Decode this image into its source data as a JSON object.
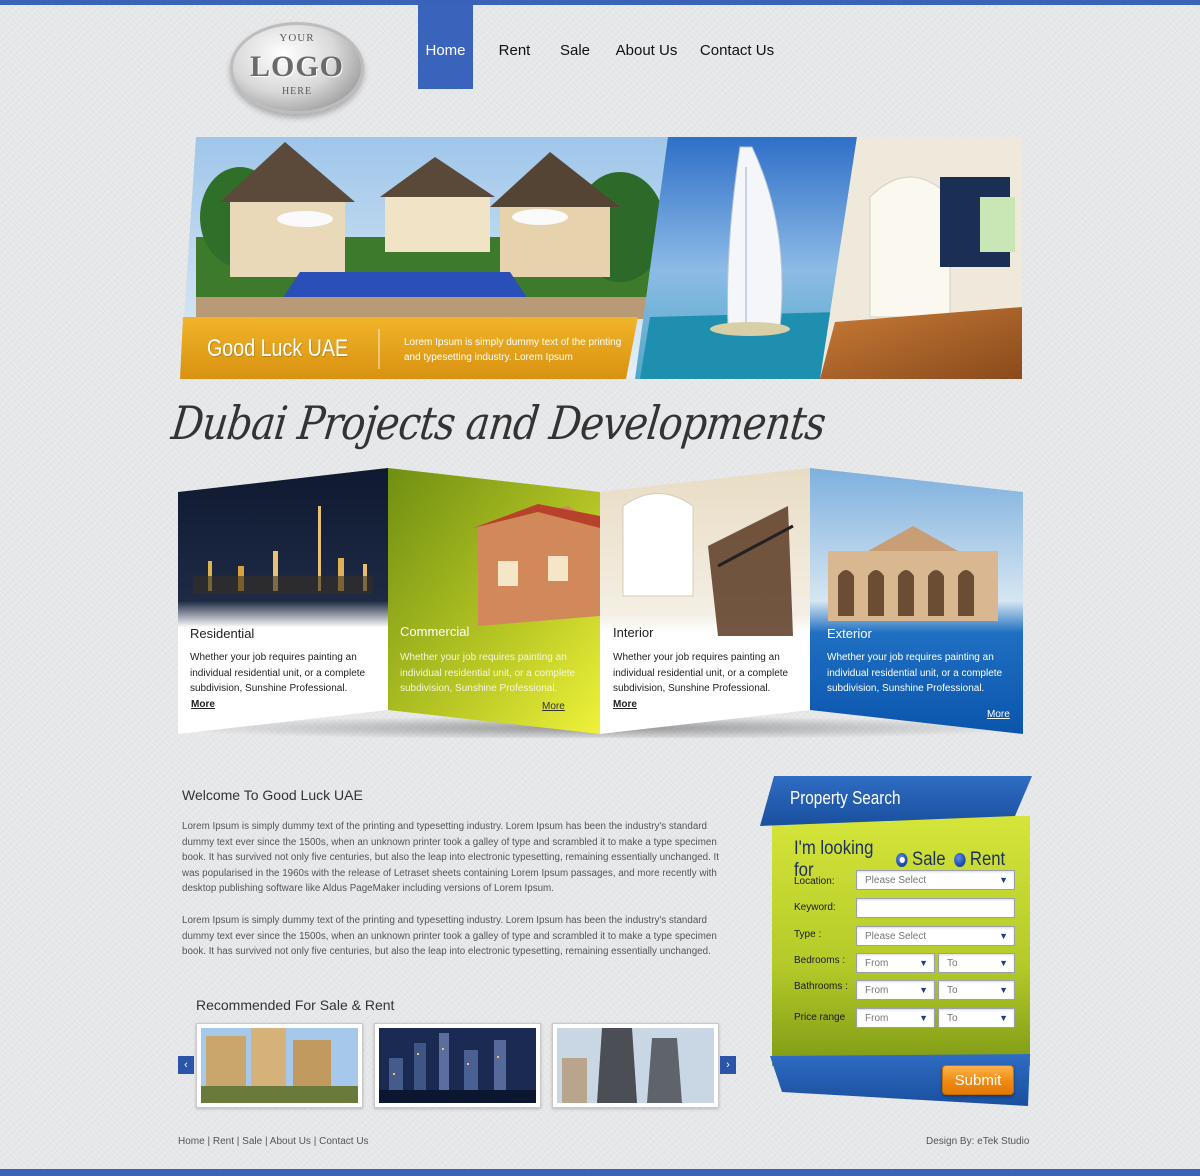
{
  "logo": {
    "top": "YOUR",
    "main": "LOGO",
    "bottom": "HERE"
  },
  "nav": {
    "items": [
      {
        "label": "Home",
        "active": true
      },
      {
        "label": "Rent"
      },
      {
        "label": "Sale"
      },
      {
        "label": "About Us"
      },
      {
        "label": "Contact Us"
      }
    ]
  },
  "hero": {
    "title": "Good Luck UAE",
    "text": "Lorem Ipsum is simply dummy text of the printing and typesetting industry. Lorem Ipsum"
  },
  "section_heading": "Dubai Projects and Developments",
  "categories": [
    {
      "title": "Residential",
      "text": "Whether your job requires painting an individual residential unit, or a complete subdivision, Sunshine Professional.",
      "more": "More"
    },
    {
      "title": "Commercial",
      "text": "Whether your job requires painting an individual residential unit, or a complete subdivision, Sunshine Professional.",
      "more": "More"
    },
    {
      "title": "Interior",
      "text": "Whether your job requires painting an individual residential unit, or a complete subdivision, Sunshine Professional.",
      "more": "More"
    },
    {
      "title": "Exterior",
      "text": "Whether your job requires painting an individual residential unit, or a complete subdivision, Sunshine Professional.",
      "more": "More"
    }
  ],
  "welcome": {
    "title": "Welcome To Good Luck UAE",
    "p1": "Lorem Ipsum is simply dummy text of the printing and typesetting industry. Lorem Ipsum has been the industry's standard dummy text ever since the 1500s, when an unknown printer took a galley of type and scrambled it to make a type specimen book. It has survived not only five centuries, but also the leap into electronic typesetting, remaining essentially unchanged. It was popularised in the 1960s with the release of Letraset sheets containing Lorem Ipsum passages, and more recently with desktop publishing software like Aldus PageMaker including versions of Lorem Ipsum.",
    "p2": "Lorem Ipsum is simply dummy text of the printing and typesetting industry. Lorem Ipsum has been the industry's standard dummy text ever since the 1500s, when an unknown printer took a galley of type and scrambled it to make a type specimen book. It has survived not only five centuries, but also the leap into electronic typesetting, remaining essentially unchanged."
  },
  "recommended": {
    "title": "Recommended For Sale & Rent",
    "prev": "‹",
    "next": "›"
  },
  "search": {
    "title": "Property Search",
    "looking_for": "I'm looking for",
    "opt_sale": "Sale",
    "opt_rent": "Rent",
    "location_label": "Location:",
    "location_value": "Please Select",
    "keyword_label": "Keyword:",
    "keyword_value": "",
    "type_label": "Type :",
    "type_value": "Please Select",
    "bedrooms_label": "Bedrooms :",
    "bathrooms_label": "Bathrooms :",
    "price_label": "Price range",
    "from": "From",
    "to": "To",
    "submit": "Submit"
  },
  "footer": {
    "links": [
      "Home",
      "Rent",
      "Sale",
      "About Us",
      "Contact Us"
    ],
    "credit": "Design By: eTek Studio"
  },
  "colors": {
    "brand_blue": "#3a64bb",
    "hero_gold": "#e4a217",
    "search_green": "#b9d02c",
    "submit_orange": "#f08a12"
  }
}
